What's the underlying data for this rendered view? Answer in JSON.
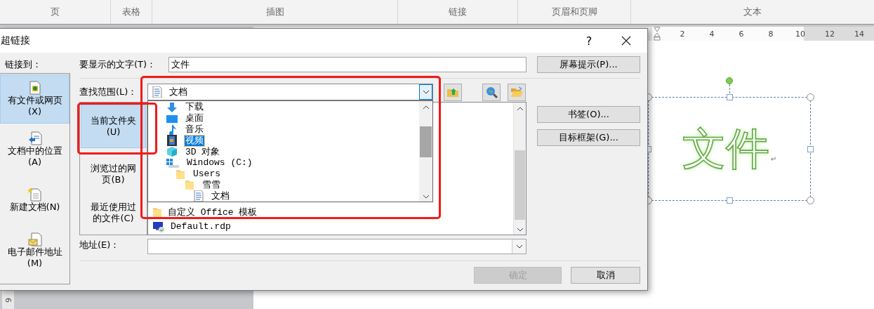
{
  "ribbon": {
    "groups": [
      "页",
      "表格",
      "插图",
      "链接",
      "页眉和页脚",
      "文本"
    ]
  },
  "ruler": {
    "labels": [
      "2",
      "4",
      "6",
      "8",
      "10",
      "12",
      "14"
    ]
  },
  "vertical_ruler": {
    "labels": [
      "6"
    ]
  },
  "dialog": {
    "title": "超链接",
    "help": "?",
    "link_to": {
      "label": "链接到：",
      "places": [
        {
          "label": "有文件或网页",
          "accel": "(X)",
          "kind": "file",
          "selected": true
        },
        {
          "label": "文档中的位置",
          "accel": "(A)",
          "kind": "bookmark",
          "selected": false
        },
        {
          "label": "新建文档(N)",
          "kind": "new",
          "selected": false
        },
        {
          "label": "电子邮件地址",
          "accel": "(M)",
          "kind": "email",
          "selected": false
        }
      ]
    },
    "display_text": {
      "label": "要显示的文字(T)：",
      "value": "文件"
    },
    "screentip_button": "屏幕提示(P)...",
    "look_in": {
      "label": "查找范围(L)：",
      "value": "文档",
      "expanded": true,
      "options": [
        {
          "label": "下载",
          "kind": "download",
          "selected": false
        },
        {
          "label": "桌面",
          "kind": "desktop",
          "selected": false
        },
        {
          "label": "音乐",
          "kind": "music",
          "selected": false
        },
        {
          "label": "视频",
          "kind": "video",
          "selected": true
        },
        {
          "label": "3D 对象",
          "kind": "cube",
          "selected": false
        },
        {
          "label": "Windows (C:)",
          "kind": "drive",
          "selected": false,
          "children": [
            {
              "label": "Users",
              "kind": "folder",
              "selected": false,
              "children": [
                {
                  "label": "雪雪",
                  "kind": "folder",
                  "selected": false,
                  "children": [
                    {
                      "label": "文档",
                      "kind": "docs",
                      "selected": false
                    }
                  ]
                }
              ]
            }
          ]
        }
      ]
    },
    "toolbar": [
      {
        "kind": "up"
      },
      {
        "kind": "web"
      },
      {
        "kind": "open"
      }
    ],
    "sources": [
      {
        "label": "当前文件夹(U)",
        "selected": true
      },
      {
        "label": "浏览过的网页(B)",
        "selected": false
      },
      {
        "label": "最近使用过的文件(C)",
        "selected": false
      }
    ],
    "files": [
      {
        "name": "自定义 Office 模板",
        "kind": "folder"
      },
      {
        "name": "Default.rdp",
        "kind": "rdp"
      }
    ],
    "side_buttons": [
      "书签(O)...",
      "目标框架(G)..."
    ],
    "address": {
      "label": "地址(E)："
    },
    "buttons": [
      {
        "label": "确定",
        "disabled": true
      },
      {
        "label": "取消",
        "disabled": false
      }
    ]
  },
  "annotations": [
    {
      "kind": "highlight"
    },
    {
      "kind": "highlight"
    }
  ],
  "document": {
    "text": "文件",
    "mark": "↵"
  }
}
